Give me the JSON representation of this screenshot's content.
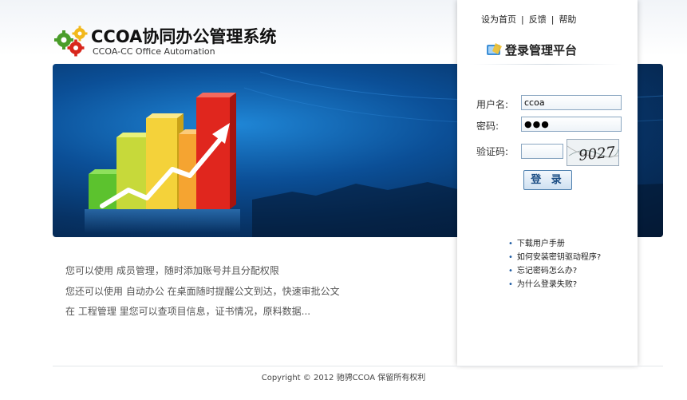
{
  "logo": {
    "title": "CCOA协同办公管理系统",
    "subtitle": "CCOA-CC Office Automation"
  },
  "toplinks": [
    "设为首页",
    "反馈",
    "帮助"
  ],
  "panel": {
    "title": "登录管理平台",
    "username_label": "用户名:",
    "username_value": "ccoa",
    "password_label": "密码:",
    "password_value": "●●●",
    "captcha_label": "验证码:",
    "captcha_value": "",
    "captcha_text": "9027",
    "login_label": "登 录"
  },
  "help_links": [
    "下载用户手册",
    "如何安装密钥驱动程序?",
    "忘记密码怎么办?",
    "为什么登录失败?"
  ],
  "features": [
    "您可以使用 成员管理，随时添加账号并且分配权限",
    "您还可以使用 自动办公 在桌面随时提醒公文到达，快速审批公文",
    "在 工程管理 里您可以查项目信息，证书情况，原料数据..."
  ],
  "footer": "Copyright © 2012 驰骋CCOA 保留所有权利",
  "colors": {
    "accent": "#1e5ca3",
    "banner_dark": "#051d3d",
    "banner_light": "#1f86d6"
  }
}
